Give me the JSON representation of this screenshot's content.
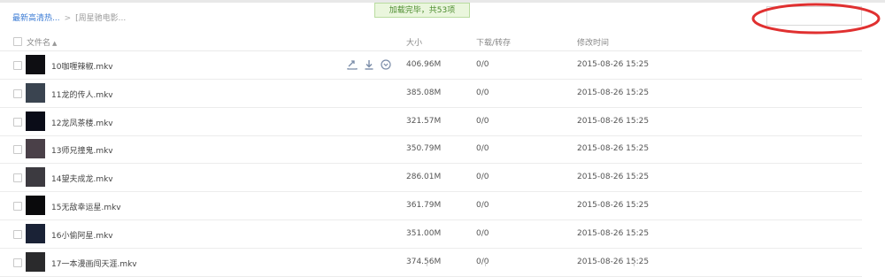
{
  "breadcrumb": {
    "root": "最新高清热...",
    "separator": ">",
    "current": "[周星驰电影..."
  },
  "toast": "加载完毕，共53项",
  "search": {
    "value": "",
    "placeholder": ""
  },
  "columns": {
    "name": "文件名",
    "size": "大小",
    "download": "下载/转存",
    "modified": "修改时间"
  },
  "rows": [
    {
      "name": "10咖喱辣椒.mkv",
      "size": "406.96M",
      "download": "0/0",
      "modified": "2015-08-26 15:25",
      "thumb_color": "#0e0e12"
    },
    {
      "name": "11龙的传人.mkv",
      "size": "385.08M",
      "download": "0/0",
      "modified": "2015-08-26 15:25",
      "thumb_color": "#3a4450"
    },
    {
      "name": "12龙凤茶楼.mkv",
      "size": "321.57M",
      "download": "0/0",
      "modified": "2015-08-26 15:25",
      "thumb_color": "#0a0c18"
    },
    {
      "name": "13师兄撞鬼.mkv",
      "size": "350.79M",
      "download": "0/0",
      "modified": "2015-08-26 15:25",
      "thumb_color": "#4a4048"
    },
    {
      "name": "14望夫成龙.mkv",
      "size": "286.01M",
      "download": "0/0",
      "modified": "2015-08-26 15:25",
      "thumb_color": "#3c3a40"
    },
    {
      "name": "15无敌幸运星.mkv",
      "size": "361.79M",
      "download": "0/0",
      "modified": "2015-08-26 15:25",
      "thumb_color": "#0a0a0c"
    },
    {
      "name": "16小偷阿星.mkv",
      "size": "351.00M",
      "download": "0/0",
      "modified": "2015-08-26 15:25",
      "thumb_color": "#1a2236"
    },
    {
      "name": "17一本漫画闯天涯.mkv",
      "size": "374.56M",
      "download": "0/0",
      "modified": "2015-08-26 15:25",
      "thumb_color": "#2a2a2c"
    }
  ],
  "row_actions": [
    "share-icon",
    "download-icon",
    "more-icon"
  ],
  "colors": {
    "link": "#3b7bd4",
    "toast_bg": "#eaf6dd",
    "toast_text": "#4a8a2c",
    "annotation": "#e03030",
    "icon": "#7a8ca8"
  }
}
